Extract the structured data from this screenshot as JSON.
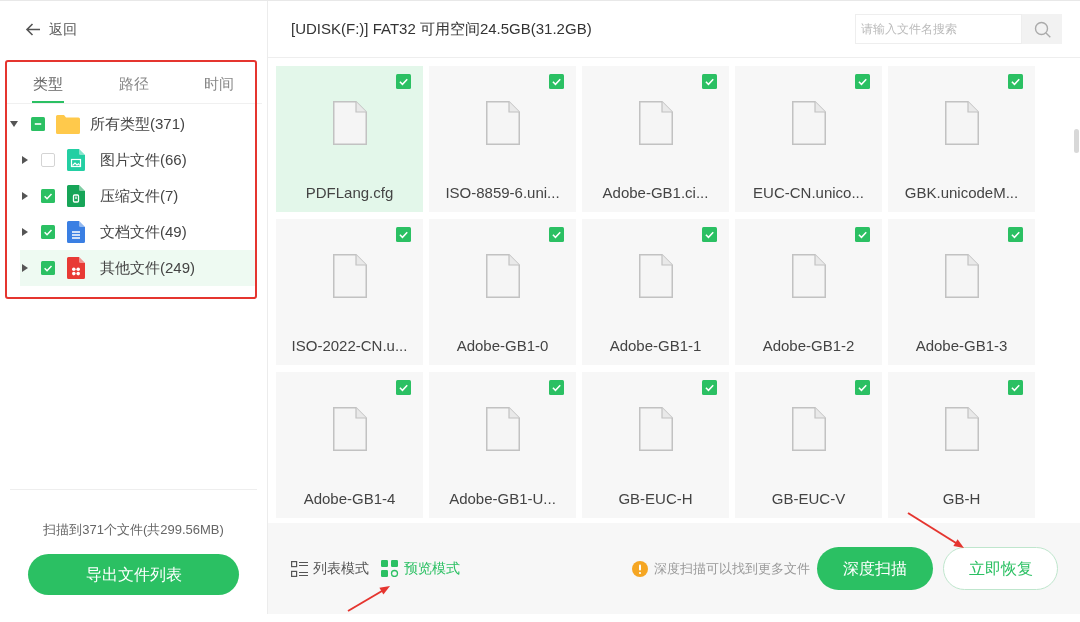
{
  "sidebar": {
    "back_label": "返回",
    "tabs": [
      {
        "label": "类型",
        "selected": true
      },
      {
        "label": "路径",
        "selected": false
      },
      {
        "label": "时间",
        "selected": false
      }
    ],
    "tree": {
      "kind": "folder",
      "label": "所有类型(371)",
      "expanded": true,
      "partial": true,
      "selected": false,
      "children": [
        {
          "kind": "image",
          "label": "图片文件(66)",
          "expanded": false,
          "checked": false,
          "selected": false
        },
        {
          "kind": "archive",
          "label": "压缩文件(7)",
          "expanded": false,
          "checked": true,
          "selected": false
        },
        {
          "kind": "document",
          "label": "文档文件(49)",
          "expanded": false,
          "checked": true,
          "selected": false
        },
        {
          "kind": "other",
          "label": "其他文件(249)",
          "expanded": false,
          "checked": true,
          "selected": true
        }
      ]
    },
    "scan_summary": "扫描到371个文件(共299.56MB)",
    "export_button": "导出文件列表"
  },
  "header": {
    "title": "[UDISK(F:)] FAT32 可用空间24.5GB(31.2GB)",
    "search": {
      "placeholder": "请输入文件名搜索"
    }
  },
  "files": [
    {
      "name": "PDFLang.cfg",
      "checked": true,
      "selected": true
    },
    {
      "name": "ISO-8859-6.uni...",
      "checked": true,
      "selected": false
    },
    {
      "name": "Adobe-GB1.ci...",
      "checked": true,
      "selected": false
    },
    {
      "name": "EUC-CN.unico...",
      "checked": true,
      "selected": false
    },
    {
      "name": "GBK.unicodeM...",
      "checked": true,
      "selected": false
    },
    {
      "name": "ISO-2022-CN.u...",
      "checked": true,
      "selected": false
    },
    {
      "name": "Adobe-GB1-0",
      "checked": true,
      "selected": false
    },
    {
      "name": "Adobe-GB1-1",
      "checked": true,
      "selected": false
    },
    {
      "name": "Adobe-GB1-2",
      "checked": true,
      "selected": false
    },
    {
      "name": "Adobe-GB1-3",
      "checked": true,
      "selected": false
    },
    {
      "name": "Adobe-GB1-4",
      "checked": true,
      "selected": false
    },
    {
      "name": "Adobe-GB1-U...",
      "checked": true,
      "selected": false
    },
    {
      "name": "GB-EUC-H",
      "checked": true,
      "selected": false
    },
    {
      "name": "GB-EUC-V",
      "checked": true,
      "selected": false
    },
    {
      "name": "GB-H",
      "checked": true,
      "selected": false
    }
  ],
  "footer": {
    "view_modes": [
      {
        "kind": "list",
        "label": "列表模式",
        "selected": false
      },
      {
        "kind": "grid",
        "label": "预览模式",
        "selected": true
      }
    ],
    "hint": "深度扫描可以找到更多文件",
    "buttons": [
      {
        "kind": "primary",
        "label": "深度扫描"
      },
      {
        "kind": "outline",
        "label": "立即恢复"
      }
    ]
  }
}
